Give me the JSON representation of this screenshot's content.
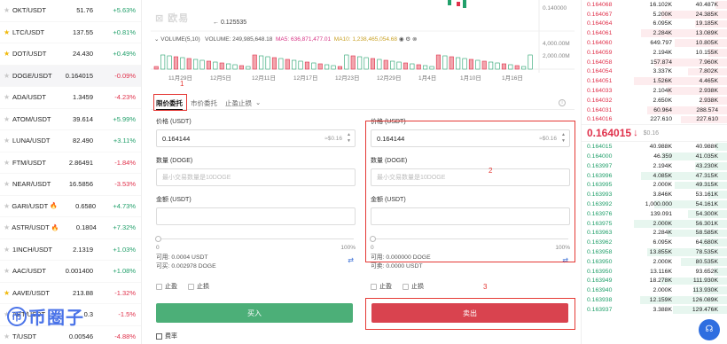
{
  "market": [
    {
      "pair": "OKT/USDT",
      "price": "51.76",
      "change": "+5.63%",
      "dir": "up",
      "fav": false,
      "hot": false
    },
    {
      "pair": "LTC/USDT",
      "price": "137.55",
      "change": "+0.81%",
      "dir": "up",
      "fav": true,
      "hot": false
    },
    {
      "pair": "DOT/USDT",
      "price": "24.430",
      "change": "+0.49%",
      "dir": "up",
      "fav": true,
      "hot": false
    },
    {
      "pair": "DOGE/USDT",
      "price": "0.164015",
      "change": "-0.09%",
      "dir": "down",
      "fav": false,
      "hot": false
    },
    {
      "pair": "ADA/USDT",
      "price": "1.3459",
      "change": "-4.23%",
      "dir": "down",
      "fav": false,
      "hot": false
    },
    {
      "pair": "ATOM/USDT",
      "price": "39.614",
      "change": "+5.99%",
      "dir": "up",
      "fav": false,
      "hot": false
    },
    {
      "pair": "LUNA/USDT",
      "price": "82.490",
      "change": "+3.11%",
      "dir": "up",
      "fav": false,
      "hot": false
    },
    {
      "pair": "FTM/USDT",
      "price": "2.86491",
      "change": "-1.84%",
      "dir": "down",
      "fav": false,
      "hot": false
    },
    {
      "pair": "NEAR/USDT",
      "price": "16.5856",
      "change": "-3.53%",
      "dir": "down",
      "fav": false,
      "hot": false
    },
    {
      "pair": "GARI/USDT",
      "price": "0.6580",
      "change": "+4.73%",
      "dir": "up",
      "fav": false,
      "hot": true
    },
    {
      "pair": "ASTR/USDT",
      "price": "0.1804",
      "change": "+7.32%",
      "dir": "up",
      "fav": false,
      "hot": true
    },
    {
      "pair": "1INCH/USDT",
      "price": "2.1319",
      "change": "+1.03%",
      "dir": "up",
      "fav": false,
      "hot": false
    },
    {
      "pair": "AAC/USDT",
      "price": "0.001400",
      "change": "+1.08%",
      "dir": "up",
      "fav": false,
      "hot": false
    },
    {
      "pair": "AAVE/USDT",
      "price": "213.88",
      "change": "-1.32%",
      "dir": "down",
      "fav": true,
      "hot": false
    },
    {
      "pair": "ABT/USDT",
      "price": "0.3",
      "change": "-1.5%",
      "dir": "down",
      "fav": false,
      "hot": false
    },
    {
      "pair": "T/USDT",
      "price": "0.00546",
      "change": "-4.88%",
      "dir": "down",
      "fav": false,
      "hot": false
    }
  ],
  "chart": {
    "min_price_label": "0.125535",
    "vol_label": "VOLUME(5,10)",
    "vol_value": "VOLUME: 249,985,648.18",
    "ma5": "MA5: 636,871,477.01",
    "ma10": "MA10: 1,238,465,054.68",
    "price_axis": "0.140000",
    "vol_axis_1": "4,000.00M",
    "vol_axis_2": "2,000.00M",
    "dates": [
      "11月29日",
      "12月5日",
      "12月11日",
      "12月17日",
      "12月23日",
      "12月29日",
      "1月4日",
      "1月10日",
      "1月16日"
    ]
  },
  "book": {
    "asks": [
      [
        "0.164068",
        "16.102K",
        "40.487K"
      ],
      [
        "0.164067",
        "5.200K",
        "24.385K"
      ],
      [
        "0.164064",
        "6.095K",
        "19.185K"
      ],
      [
        "0.164061",
        "2.284K",
        "13.089K"
      ],
      [
        "0.164060",
        "649.797",
        "10.805K"
      ],
      [
        "0.164059",
        "2.194K",
        "10.155K"
      ],
      [
        "0.164058",
        "157.874",
        "7.960K"
      ],
      [
        "0.164054",
        "3.337K",
        "7.802K"
      ],
      [
        "0.164051",
        "1.526K",
        "4.465K"
      ],
      [
        "0.164033",
        "2.104K",
        "2.938K"
      ],
      [
        "0.164032",
        "2.650K",
        "2.938K"
      ],
      [
        "0.164031",
        "60.964",
        "288.574"
      ],
      [
        "0.164016",
        "227.610",
        "227.610"
      ]
    ],
    "last_price": "0.164015",
    "index_price": "$0.16",
    "bids": [
      [
        "0.164015",
        "40.988K",
        "40.988K"
      ],
      [
        "0.164000",
        "46.359",
        "41.035K"
      ],
      [
        "0.163997",
        "2.194K",
        "43.230K"
      ],
      [
        "0.163996",
        "4.085K",
        "47.315K"
      ],
      [
        "0.163995",
        "2.000K",
        "49.315K"
      ],
      [
        "0.163993",
        "3.846K",
        "53.161K"
      ],
      [
        "0.163992",
        "1,000.000",
        "54.161K"
      ],
      [
        "0.163976",
        "139.091",
        "54.300K"
      ],
      [
        "0.163975",
        "2.000K",
        "56.301K"
      ],
      [
        "0.163963",
        "2.284K",
        "58.585K"
      ],
      [
        "0.163962",
        "6.095K",
        "64.680K"
      ],
      [
        "0.163958",
        "13.855K",
        "78.535K"
      ],
      [
        "0.163950",
        "2.000K",
        "80.535K"
      ],
      [
        "0.163950",
        "13.116K",
        "93.652K"
      ],
      [
        "0.163949",
        "18.278K",
        "111.930K"
      ],
      [
        "0.163940",
        "2.000K",
        "113.930K"
      ],
      [
        "0.163938",
        "12.159K",
        "126.089K"
      ],
      [
        "0.163937",
        "3.388K",
        "129.476K"
      ]
    ]
  },
  "form": {
    "tabs": [
      "限价委托",
      "市价委托",
      "止盈止损"
    ],
    "annotations": [
      "1",
      "2",
      "3"
    ],
    "buy": {
      "price_label": "价格 (USDT)",
      "price_value": "0.164144",
      "price_approx": "≈$0.16",
      "qty_label": "数量 (DOGE)",
      "qty_placeholder": "最小交易数量是10DOGE",
      "amount_label": "金额 (USDT)",
      "slider_min": "0",
      "slider_max": "100%",
      "avail_1": "可用: 0.0004 USDT",
      "avail_2": "可买: 0.002978 DOGE",
      "take_profit": "止盈",
      "stop_loss": "止损",
      "button": "买入"
    },
    "sell": {
      "price_label": "价格 (USDT)",
      "price_value": "0.164144",
      "price_approx": "≈$0.16",
      "qty_label": "数量 (DOGE)",
      "qty_placeholder": "最小交易数量是10DOGE",
      "amount_label": "金额 (USDT)",
      "slider_min": "0",
      "slider_max": "100%",
      "avail_1": "可用: 0.000000 DOGE",
      "avail_2": "可卖: 0.0000 USDT",
      "take_profit": "止盈",
      "stop_loss": "止损",
      "button": "卖出"
    },
    "fee_label": "费率"
  },
  "logo": {
    "mark": "币",
    "text": "币圈子"
  },
  "colors": {
    "up": "#22a06b",
    "down": "#e0314b",
    "buy_button": "#4caf78",
    "sell_button": "#d9434f",
    "annotation": "#e53935"
  }
}
